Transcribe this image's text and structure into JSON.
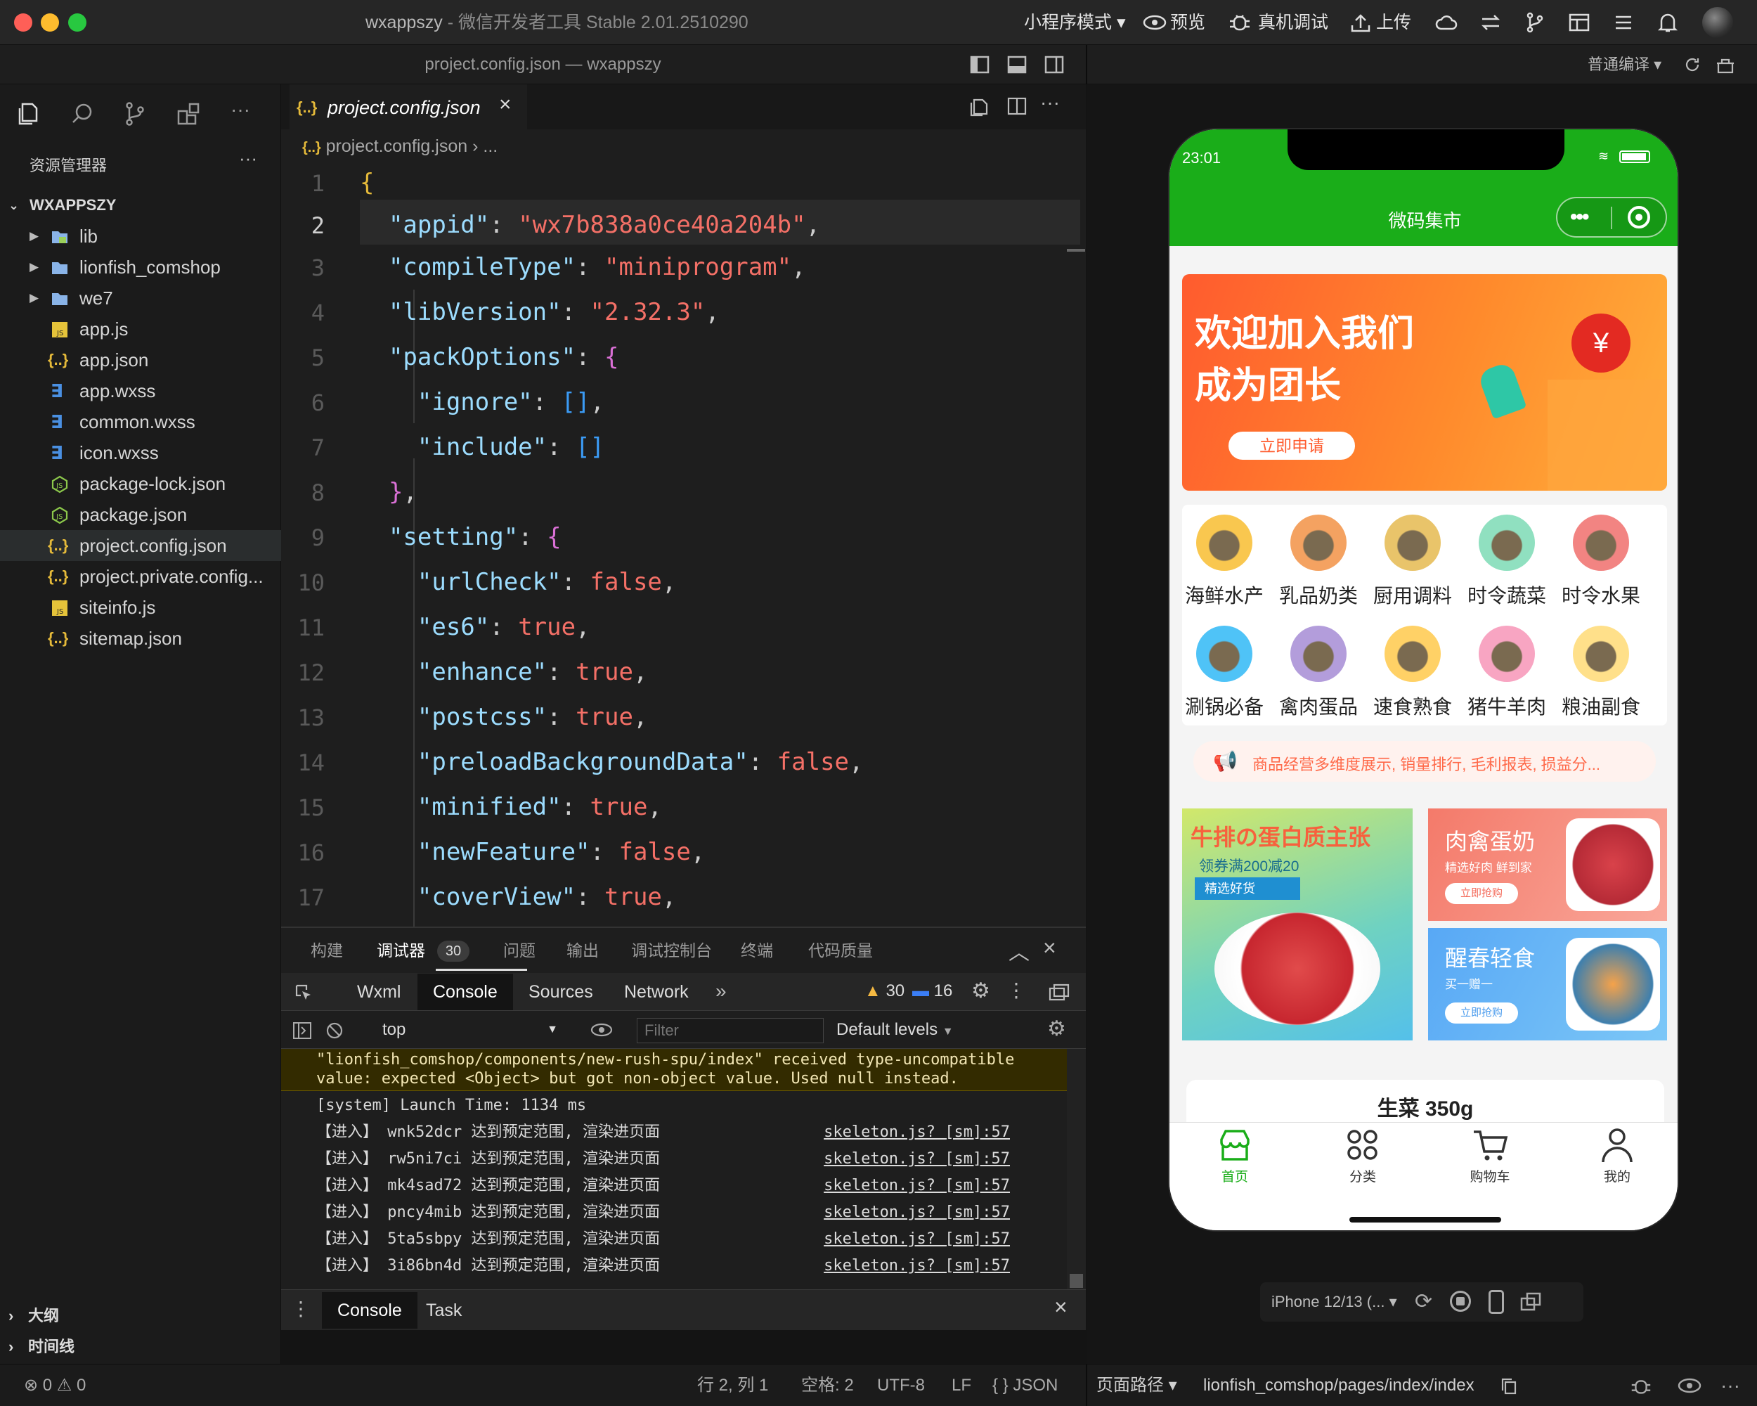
{
  "window": {
    "app_name": "wxappszy",
    "app_title": "微信开发者工具 Stable 2.01.2510290",
    "subtitle": "project.config.json — wxappszy"
  },
  "toolbar": {
    "mode": "小程序模式",
    "preview": "预览",
    "debug": "真机调试",
    "upload": "上传",
    "compile": "普通编译"
  },
  "sidebar": {
    "title": "资源管理器",
    "project": "WXAPPSZY",
    "items": [
      {
        "label": "lib",
        "type": "folder-lib"
      },
      {
        "label": "lionfish_comshop",
        "type": "folder"
      },
      {
        "label": "we7",
        "type": "folder"
      },
      {
        "label": "app.js",
        "type": "js"
      },
      {
        "label": "app.json",
        "type": "json"
      },
      {
        "label": "app.wxss",
        "type": "css"
      },
      {
        "label": "common.wxss",
        "type": "css"
      },
      {
        "label": "icon.wxss",
        "type": "css"
      },
      {
        "label": "package-lock.json",
        "type": "node"
      },
      {
        "label": "package.json",
        "type": "node"
      },
      {
        "label": "project.config.json",
        "type": "json"
      },
      {
        "label": "project.private.config...",
        "type": "json"
      },
      {
        "label": "siteinfo.js",
        "type": "js"
      },
      {
        "label": "sitemap.json",
        "type": "json"
      }
    ],
    "outline": "大纲",
    "timeline": "时间线"
  },
  "editor": {
    "tab_label": "project.config.json",
    "breadcrumb": "project.config.json",
    "breadcrumb_more": "...",
    "lines": [
      "1",
      "2",
      "3",
      "4",
      "5",
      "6",
      "7",
      "8",
      "9",
      "10",
      "11",
      "12",
      "13",
      "14",
      "15",
      "16",
      "17"
    ],
    "code": {
      "appid_key": "\"appid\"",
      "appid_val": "\"wx7b838a0ce40a204b\"",
      "compile_key": "\"compileType\"",
      "compile_val": "\"miniprogram\"",
      "lib_key": "\"libVersion\"",
      "lib_val": "\"2.32.3\"",
      "pack_key": "\"packOptions\"",
      "ignore_key": "\"ignore\"",
      "include_key": "\"include\"",
      "setting_key": "\"setting\"",
      "url_key": "\"urlCheck\"",
      "es6_key": "\"es6\"",
      "enhance_key": "\"enhance\"",
      "postcss_key": "\"postcss\"",
      "preload_key": "\"preloadBackgroundData\"",
      "minified_key": "\"minified\"",
      "newf_key": "\"newFeature\"",
      "cover_key": "\"coverView\"",
      "true": "true",
      "false": "false"
    }
  },
  "panel": {
    "tabs": [
      "构建",
      "调试器",
      "问题",
      "输出",
      "调试控制台",
      "终端",
      "代码质量"
    ],
    "debugger_count": "30",
    "devtabs": [
      "Wxml",
      "Console",
      "Sources",
      "Network"
    ],
    "warn_count": "30",
    "info_count": "16",
    "context": "top",
    "filter_placeholder": "Filter",
    "levels": "Default levels",
    "warning_line1": "\"lionfish_comshop/components/new-rush-spu/index\" received type-uncompatible",
    "warning_line2": "value: expected <Object> but got non-object value. Used null instead.",
    "system_line": "[system] Launch Time: 1134 ms",
    "logs": [
      {
        "text": "【进入】 wnk52dcr 达到预定范围, 渲染进页面",
        "src": "skeleton.js? [sm]:57"
      },
      {
        "text": "【进入】 rw5ni7ci 达到预定范围, 渲染进页面",
        "src": "skeleton.js? [sm]:57"
      },
      {
        "text": "【进入】 mk4sad72 达到预定范围, 渲染进页面",
        "src": "skeleton.js? [sm]:57"
      },
      {
        "text": "【进入】 pncy4mib 达到预定范围, 渲染进页面",
        "src": "skeleton.js? [sm]:57"
      },
      {
        "text": "【进入】 5ta5sbpy 达到预定范围, 渲染进页面",
        "src": "skeleton.js? [sm]:57"
      },
      {
        "text": "【进入】 3i86bn4d 达到预定范围, 渲染进页面",
        "src": "skeleton.js? [sm]:57"
      }
    ],
    "prompt": "›",
    "drawer_console": "Console",
    "drawer_task": "Task"
  },
  "status": {
    "errors": "0",
    "warnings": "0",
    "position": "行 2, 列 1",
    "spaces": "空格: 2",
    "encoding": "UTF-8",
    "eol": "LF",
    "language": "{ } JSON",
    "page_path_label": "页面路径",
    "page_path": "lionfish_comshop/pages/index/index"
  },
  "simulator": {
    "device": "iPhone 12/13 (...",
    "time": "23:01",
    "app_title": "微码集市",
    "banner_line1": "欢迎加入我们",
    "banner_line2": "成为团长",
    "banner_button": "立即申请",
    "categories": [
      "海鲜水产",
      "乳品奶类",
      "厨用调料",
      "时令蔬菜",
      "时令水果",
      "涮锅必备",
      "禽肉蛋品",
      "速食熟食",
      "猪牛羊肉",
      "粮油副食"
    ],
    "notice": "商品经营多维度展示, 销量排行, 毛利报表, 损益分...",
    "promo1_title": "牛排の蛋白质主张",
    "promo1_sub": "领券满200减20",
    "promo1_tag": "精选好货",
    "promo2_title": "肉禽蛋奶",
    "promo2_sub": "精选好肉 鲜到家",
    "promo2_btn": "立即抢购",
    "promo3_title": "醒春轻食",
    "promo3_sub": "买一赠一",
    "promo3_btn": "立即抢购",
    "product_title": "生菜 350g",
    "tabs": [
      "首页",
      "分类",
      "购物车",
      "我的"
    ],
    "colors": {
      "brand": "#1aad19",
      "banner": "#ff7a3d"
    }
  }
}
